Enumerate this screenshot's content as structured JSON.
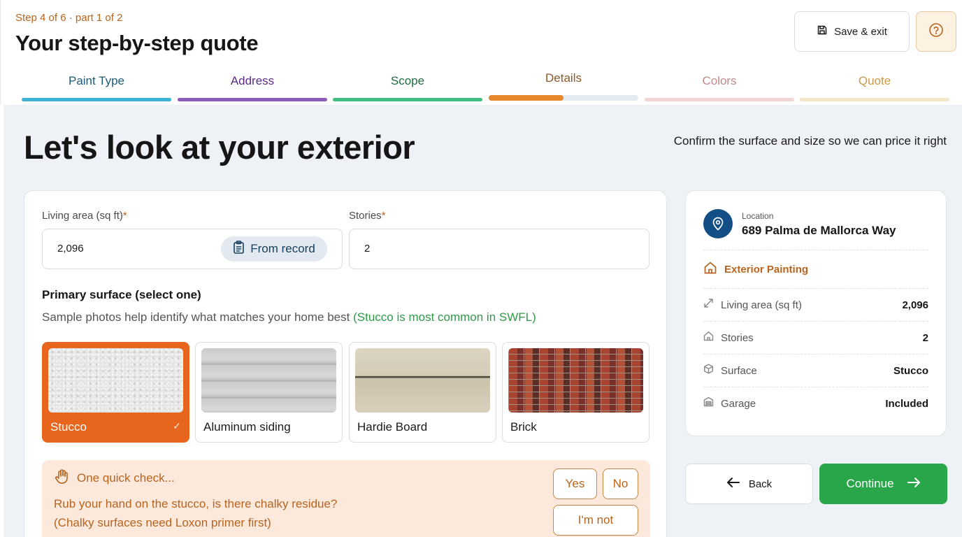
{
  "header": {
    "step_label": "Step 4 of 6 · part 1 of 2",
    "title": "Your step-by-step quote",
    "save_label": "Save & exit"
  },
  "tabs": [
    {
      "label": "Paint Type",
      "color": "#3bb3d6",
      "text_color": "#1d5a74"
    },
    {
      "label": "Address",
      "color": "#8a5bb8",
      "text_color": "#5b2b86"
    },
    {
      "label": "Scope",
      "color": "#3fbf7f",
      "text_color": "#1f6b3f"
    },
    {
      "label": "Details",
      "color": "#e8862e",
      "text_color": "#8a5a2a",
      "active": true,
      "progress": 0.5
    },
    {
      "label": "Colors",
      "color": "#f4d4d4",
      "text_color": "#c08a8a"
    },
    {
      "label": "Quote",
      "color": "#f6e6c8",
      "text_color": "#c99a4a"
    }
  ],
  "hero": {
    "title": "Let's look at your exterior",
    "subtitle": "Confirm the surface and size so we can price it right"
  },
  "form": {
    "living_area_label": "Living area (sq ft)",
    "living_area_value": "2,096",
    "from_record_label": "From record",
    "stories_label": "Stories",
    "stories_value": "2",
    "required_mark": "*",
    "surface_title": "Primary surface (select one)",
    "surface_hint": "Sample photos help identify what matches your home best",
    "surface_hint_green": "(Stucco is most common in SWFL)",
    "surfaces": [
      {
        "label": "Stucco",
        "selected": true
      },
      {
        "label": "Aluminum siding"
      },
      {
        "label": "Hardie Board"
      },
      {
        "label": "Brick"
      }
    ]
  },
  "quick_check": {
    "title": "One quick check...",
    "line1": "Rub your hand on the stucco, is there chalky residue?",
    "line2": "(Chalky surfaces need Loxon primer first)",
    "yes": "Yes",
    "no": "No",
    "not_sure": "I'm not"
  },
  "summary": {
    "location_label": "Location",
    "location_value": "689 Palma de Mallorca Way",
    "service": "Exterior Painting",
    "rows": [
      {
        "key": "Living area (sq ft)",
        "value": "2,096",
        "icon": "resize-icon"
      },
      {
        "key": "Stories",
        "value": "2",
        "icon": "house-icon"
      },
      {
        "key": "Surface",
        "value": "Stucco",
        "icon": "cube-icon"
      },
      {
        "key": "Garage",
        "value": "Included",
        "icon": "garage-icon"
      }
    ]
  },
  "nav": {
    "back": "Back",
    "continue": "Continue"
  },
  "colors": {
    "accent_orange": "#e8651e",
    "brand_blue": "#134f86",
    "continue_green": "#2aa64a"
  }
}
